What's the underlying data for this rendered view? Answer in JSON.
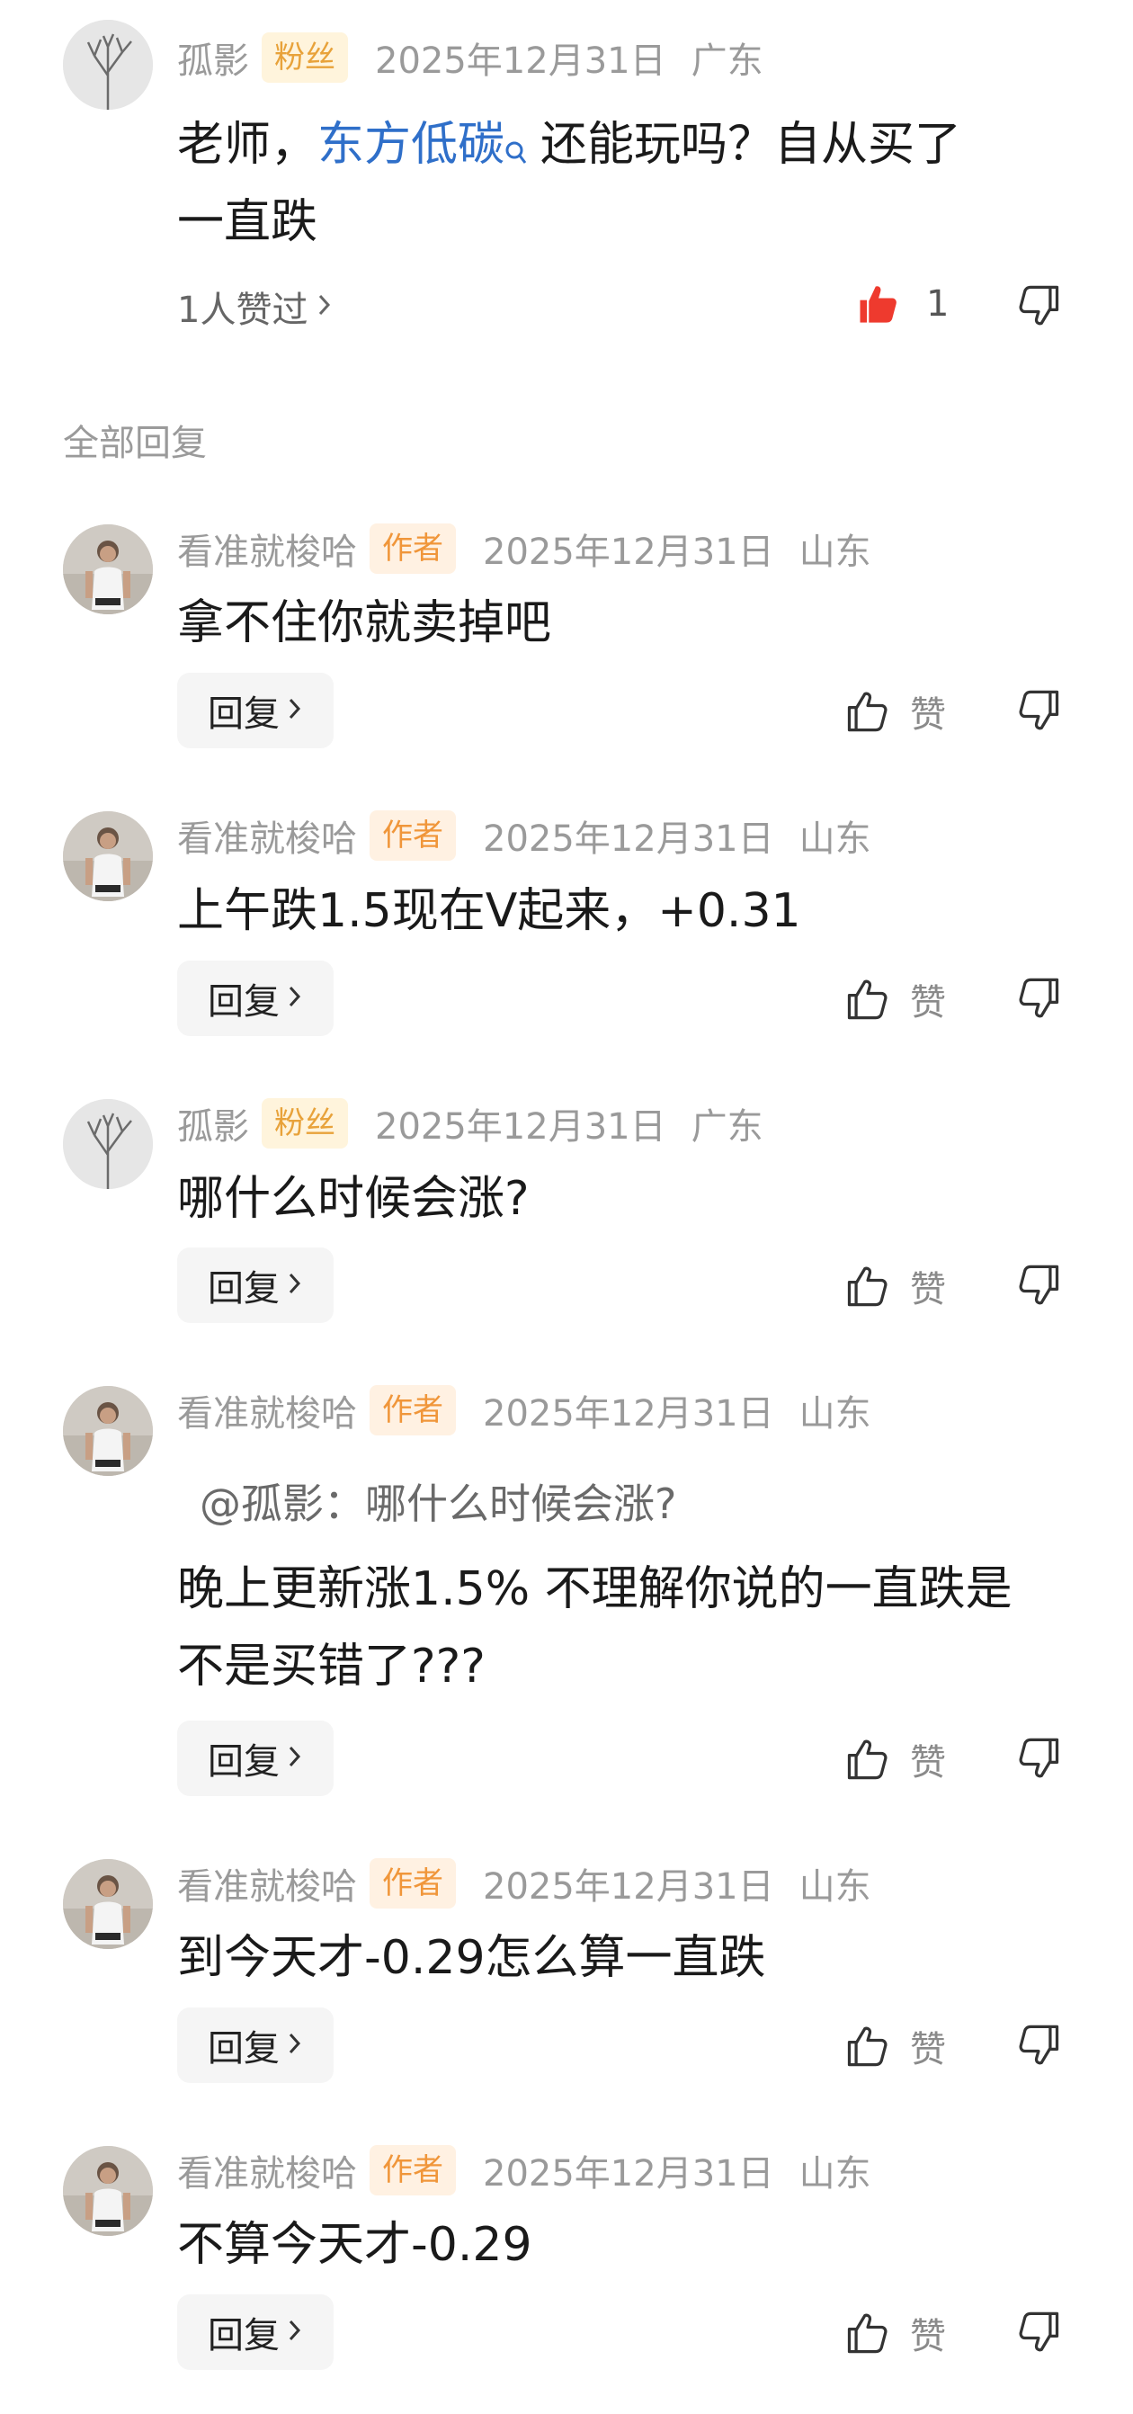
{
  "main_comment": {
    "user": "孤影",
    "badge": "粉丝",
    "time": "2025年12月31日",
    "location": "广东",
    "text_before_link": "老师，",
    "link_text": "东方低碳",
    "text_after_link": "还能玩吗？自从买了",
    "text_line2": "一直跌",
    "likers": "1人赞过",
    "like_count": "1"
  },
  "section_title": "全部回复",
  "reply_label": "回复",
  "like_label": "赞",
  "replies": [
    {
      "user": "看准就梭哈",
      "badge": "作者",
      "time": "2025年12月31日",
      "location": "山东",
      "text": "拿不住你就卖掉吧"
    },
    {
      "user": "看准就梭哈",
      "badge": "作者",
      "time": "2025年12月31日",
      "location": "山东",
      "text": "上午跌1.5现在V起来，+0.31"
    },
    {
      "user": "孤影",
      "badge": "粉丝",
      "time": "2025年12月31日",
      "location": "广东",
      "text": "哪什么时候会涨?"
    },
    {
      "user": "看准就梭哈",
      "badge": "作者",
      "time": "2025年12月31日",
      "location": "山东",
      "quote": "@孤影：哪什么时候会涨?",
      "text": "晚上更新涨1.5% 不理解你说的一直跌是",
      "text2": "不是买错了???"
    },
    {
      "user": "看准就梭哈",
      "badge": "作者",
      "time": "2025年12月31日",
      "location": "山东",
      "text": "到今天才-0.29怎么算一直跌"
    },
    {
      "user": "看准就梭哈",
      "badge": "作者",
      "time": "2025年12月31日",
      "location": "山东",
      "text": "不算今天才-0.29"
    }
  ]
}
